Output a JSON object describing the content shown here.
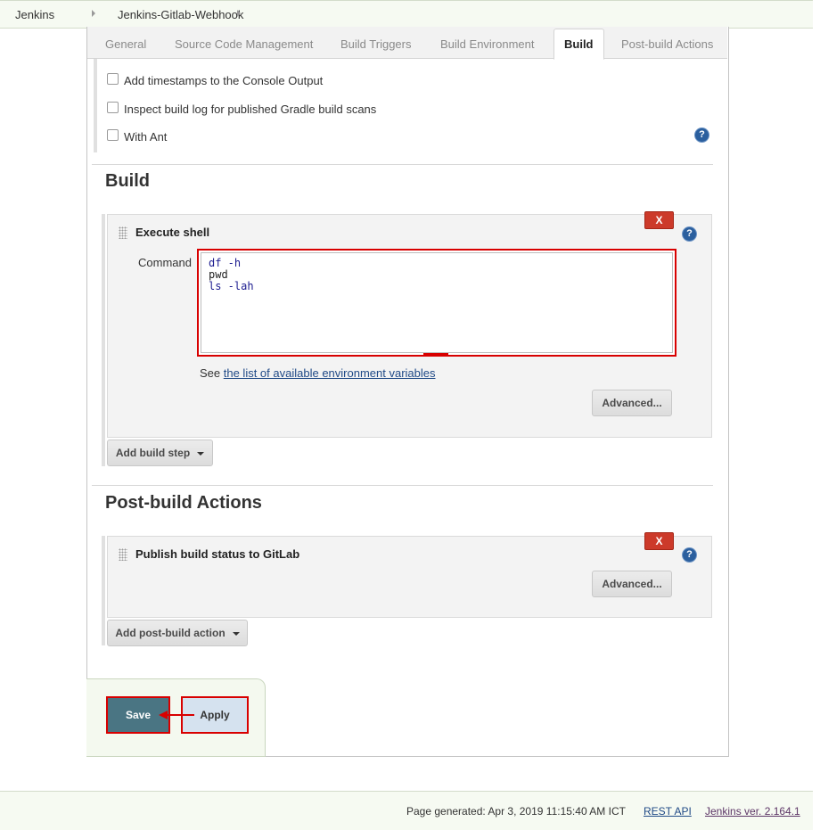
{
  "breadcrumb": {
    "items": [
      "Jenkins",
      "Jenkins-Gitlab-Webhook"
    ]
  },
  "tabs": [
    {
      "label": "General"
    },
    {
      "label": "Source Code Management"
    },
    {
      "label": "Build Triggers"
    },
    {
      "label": "Build Environment"
    },
    {
      "label": "Build",
      "active": true
    },
    {
      "label": "Post-build Actions"
    }
  ],
  "build_environment": {
    "options": [
      {
        "label": "Add timestamps to the Console Output",
        "checked": false
      },
      {
        "label": "Inspect build log for published Gradle build scans",
        "checked": false
      },
      {
        "label": "With Ant",
        "checked": false
      }
    ]
  },
  "build": {
    "title": "Build",
    "step": {
      "title": "Execute shell",
      "delete_label": "X",
      "command_label": "Command",
      "command_lines": [
        {
          "cmd": "df",
          "arg": " -h"
        },
        {
          "cmd": "pwd",
          "arg": ""
        },
        {
          "cmd": "ls",
          "arg": " -lah"
        }
      ],
      "see_text": "See ",
      "env_link": "the list of available environment variables",
      "advanced_label": "Advanced..."
    },
    "add_step_label": "Add build step"
  },
  "post_build": {
    "title": "Post-build Actions",
    "action": {
      "title": "Publish build status to GitLab",
      "delete_label": "X",
      "advanced_label": "Advanced..."
    },
    "add_action_label": "Add post-build action"
  },
  "buttons": {
    "save": "Save",
    "apply": "Apply"
  },
  "footer": {
    "generated": "Page generated: Apr 3, 2019 11:15:40 AM ICT",
    "rest_api": "REST API",
    "version": "Jenkins ver. 2.164.1"
  },
  "colors": {
    "highlight": "#d80000",
    "save_bg": "#4a7583",
    "apply_bg": "#d5e2ef",
    "delete_bg": "#cc3a2a"
  },
  "icons": {
    "help": "help-icon",
    "grip": "drag-handle-icon",
    "dropdown": "caret-down-icon"
  }
}
